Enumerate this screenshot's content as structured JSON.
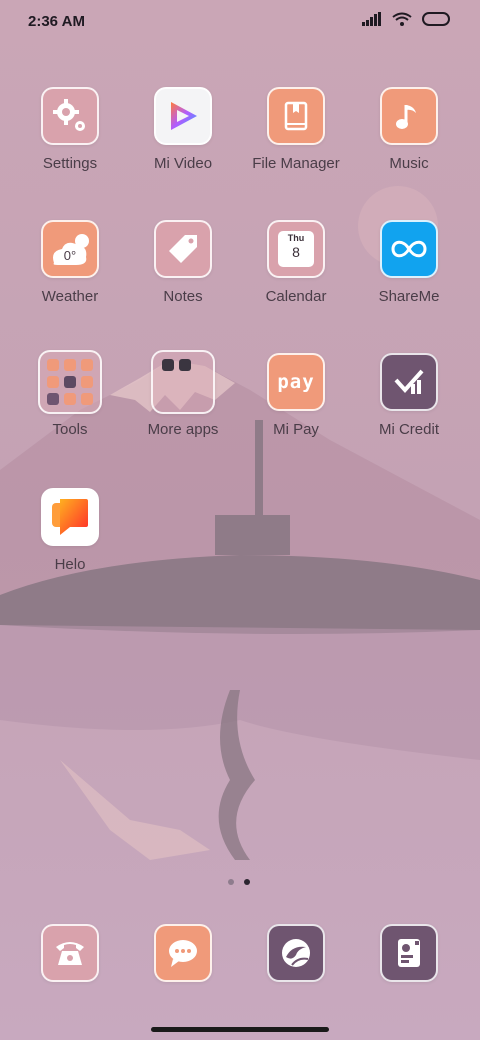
{
  "status_bar": {
    "time": "2:36 AM"
  },
  "apps": [
    {
      "label": "Settings"
    },
    {
      "label": "Mi Video"
    },
    {
      "label": "File Manager"
    },
    {
      "label": "Music"
    },
    {
      "label": "Weather",
      "temp": "0°"
    },
    {
      "label": "Notes"
    },
    {
      "label": "Calendar",
      "weekday": "Thu",
      "day": "8"
    },
    {
      "label": "ShareMe"
    },
    {
      "label": "Tools"
    },
    {
      "label": "More apps"
    },
    {
      "label": "Mi Pay",
      "badge": "pay"
    },
    {
      "label": "Mi Credit"
    },
    {
      "label": "Helo"
    }
  ],
  "dock": [
    {
      "name": "Phone",
      "icon": "phone-icon"
    },
    {
      "name": "Messages",
      "icon": "message-icon"
    },
    {
      "name": "Browser",
      "icon": "browser-icon"
    },
    {
      "name": "Contacts",
      "icon": "contacts-icon"
    }
  ],
  "pager": {
    "pages": 2,
    "current": 2
  },
  "colors": {
    "peach": "#f09a7a",
    "pink": "#d9a2ac",
    "purple": "#6f5570",
    "blue": "#11a3ef"
  }
}
